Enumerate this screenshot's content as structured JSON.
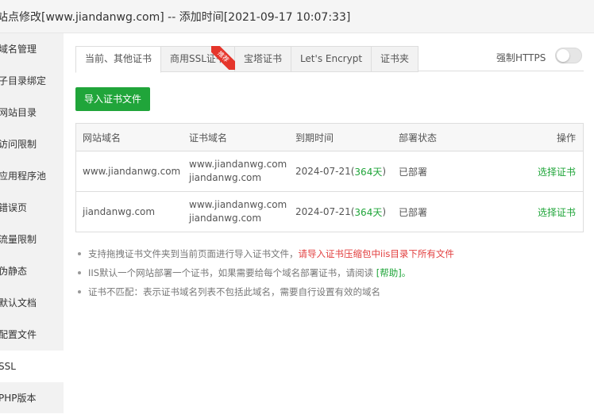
{
  "window": {
    "title": "站点修改[www.jiandanwg.com] -- 添加时间[2021-09-17 10:07:33]"
  },
  "sidebar": {
    "items": [
      {
        "label": "域名管理"
      },
      {
        "label": "子目录绑定"
      },
      {
        "label": "网站目录"
      },
      {
        "label": "访问限制"
      },
      {
        "label": "应用程序池"
      },
      {
        "label": "错误页"
      },
      {
        "label": "流量限制"
      },
      {
        "label": "伪静态"
      },
      {
        "label": "默认文档"
      },
      {
        "label": "配置文件"
      },
      {
        "label": "SSL"
      },
      {
        "label": "PHP版本"
      }
    ]
  },
  "tabs": [
    {
      "label": "当前、其他证书"
    },
    {
      "label": "商用SSL证书",
      "badge": "推荐"
    },
    {
      "label": "宝塔证书"
    },
    {
      "label": "Let's Encrypt"
    },
    {
      "label": "证书夹"
    }
  ],
  "https": {
    "label": "强制HTTPS"
  },
  "import_button": {
    "label": "导入证书文件"
  },
  "table": {
    "headers": [
      "网站域名",
      "证书域名",
      "到期时间",
      "部署状态",
      "操作"
    ],
    "rows": [
      {
        "site": "www.jiandanwg.com",
        "cert1": "www.jiandanwg.com",
        "cert2": "jiandanwg.com",
        "expire": "2024-07-21(",
        "days": "364天",
        "expire_end": ")",
        "status": "已部署",
        "action": "选择证书"
      },
      {
        "site": "jiandanwg.com",
        "cert1": "www.jiandanwg.com",
        "cert2": "jiandanwg.com",
        "expire": "2024-07-21(",
        "days": "364天",
        "expire_end": ")",
        "status": "已部署",
        "action": "选择证书"
      }
    ]
  },
  "notes": [
    {
      "text": "支持拖拽证书文件夹到当前页面进行导入证书文件，",
      "highlight": "请导入证书压缩包中iis目录下所有文件"
    },
    {
      "text": "IIS默认一个网站部署一个证书，如果需要给每个域名部署证书，请阅读 ",
      "link": "[帮助]",
      "tail": "。"
    },
    {
      "text": "证书不匹配：表示证书域名列表不包括此域名，需要自行设置有效的域名"
    }
  ],
  "colors": {
    "accent": "#20a53a",
    "warning": "#e23e3e",
    "badge": "#e5352b"
  }
}
